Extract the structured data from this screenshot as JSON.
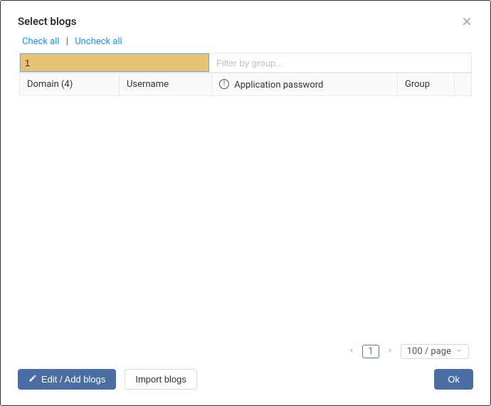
{
  "modal": {
    "title": "Select blogs",
    "close_label": "Close"
  },
  "actions": {
    "check_all": "Check all",
    "uncheck_all": "Uncheck all",
    "separator": "|"
  },
  "filters": {
    "search_value": "1",
    "group_placeholder": "Filter by group..."
  },
  "table": {
    "columns": {
      "domain": "Domain (4)",
      "username": "Username",
      "app_password": "Application password",
      "group": "Group"
    }
  },
  "pagination": {
    "current_page": "1",
    "page_size_label": "100 / page"
  },
  "footer": {
    "edit_add": "Edit / Add blogs",
    "import": "Import blogs",
    "ok": "Ok"
  }
}
